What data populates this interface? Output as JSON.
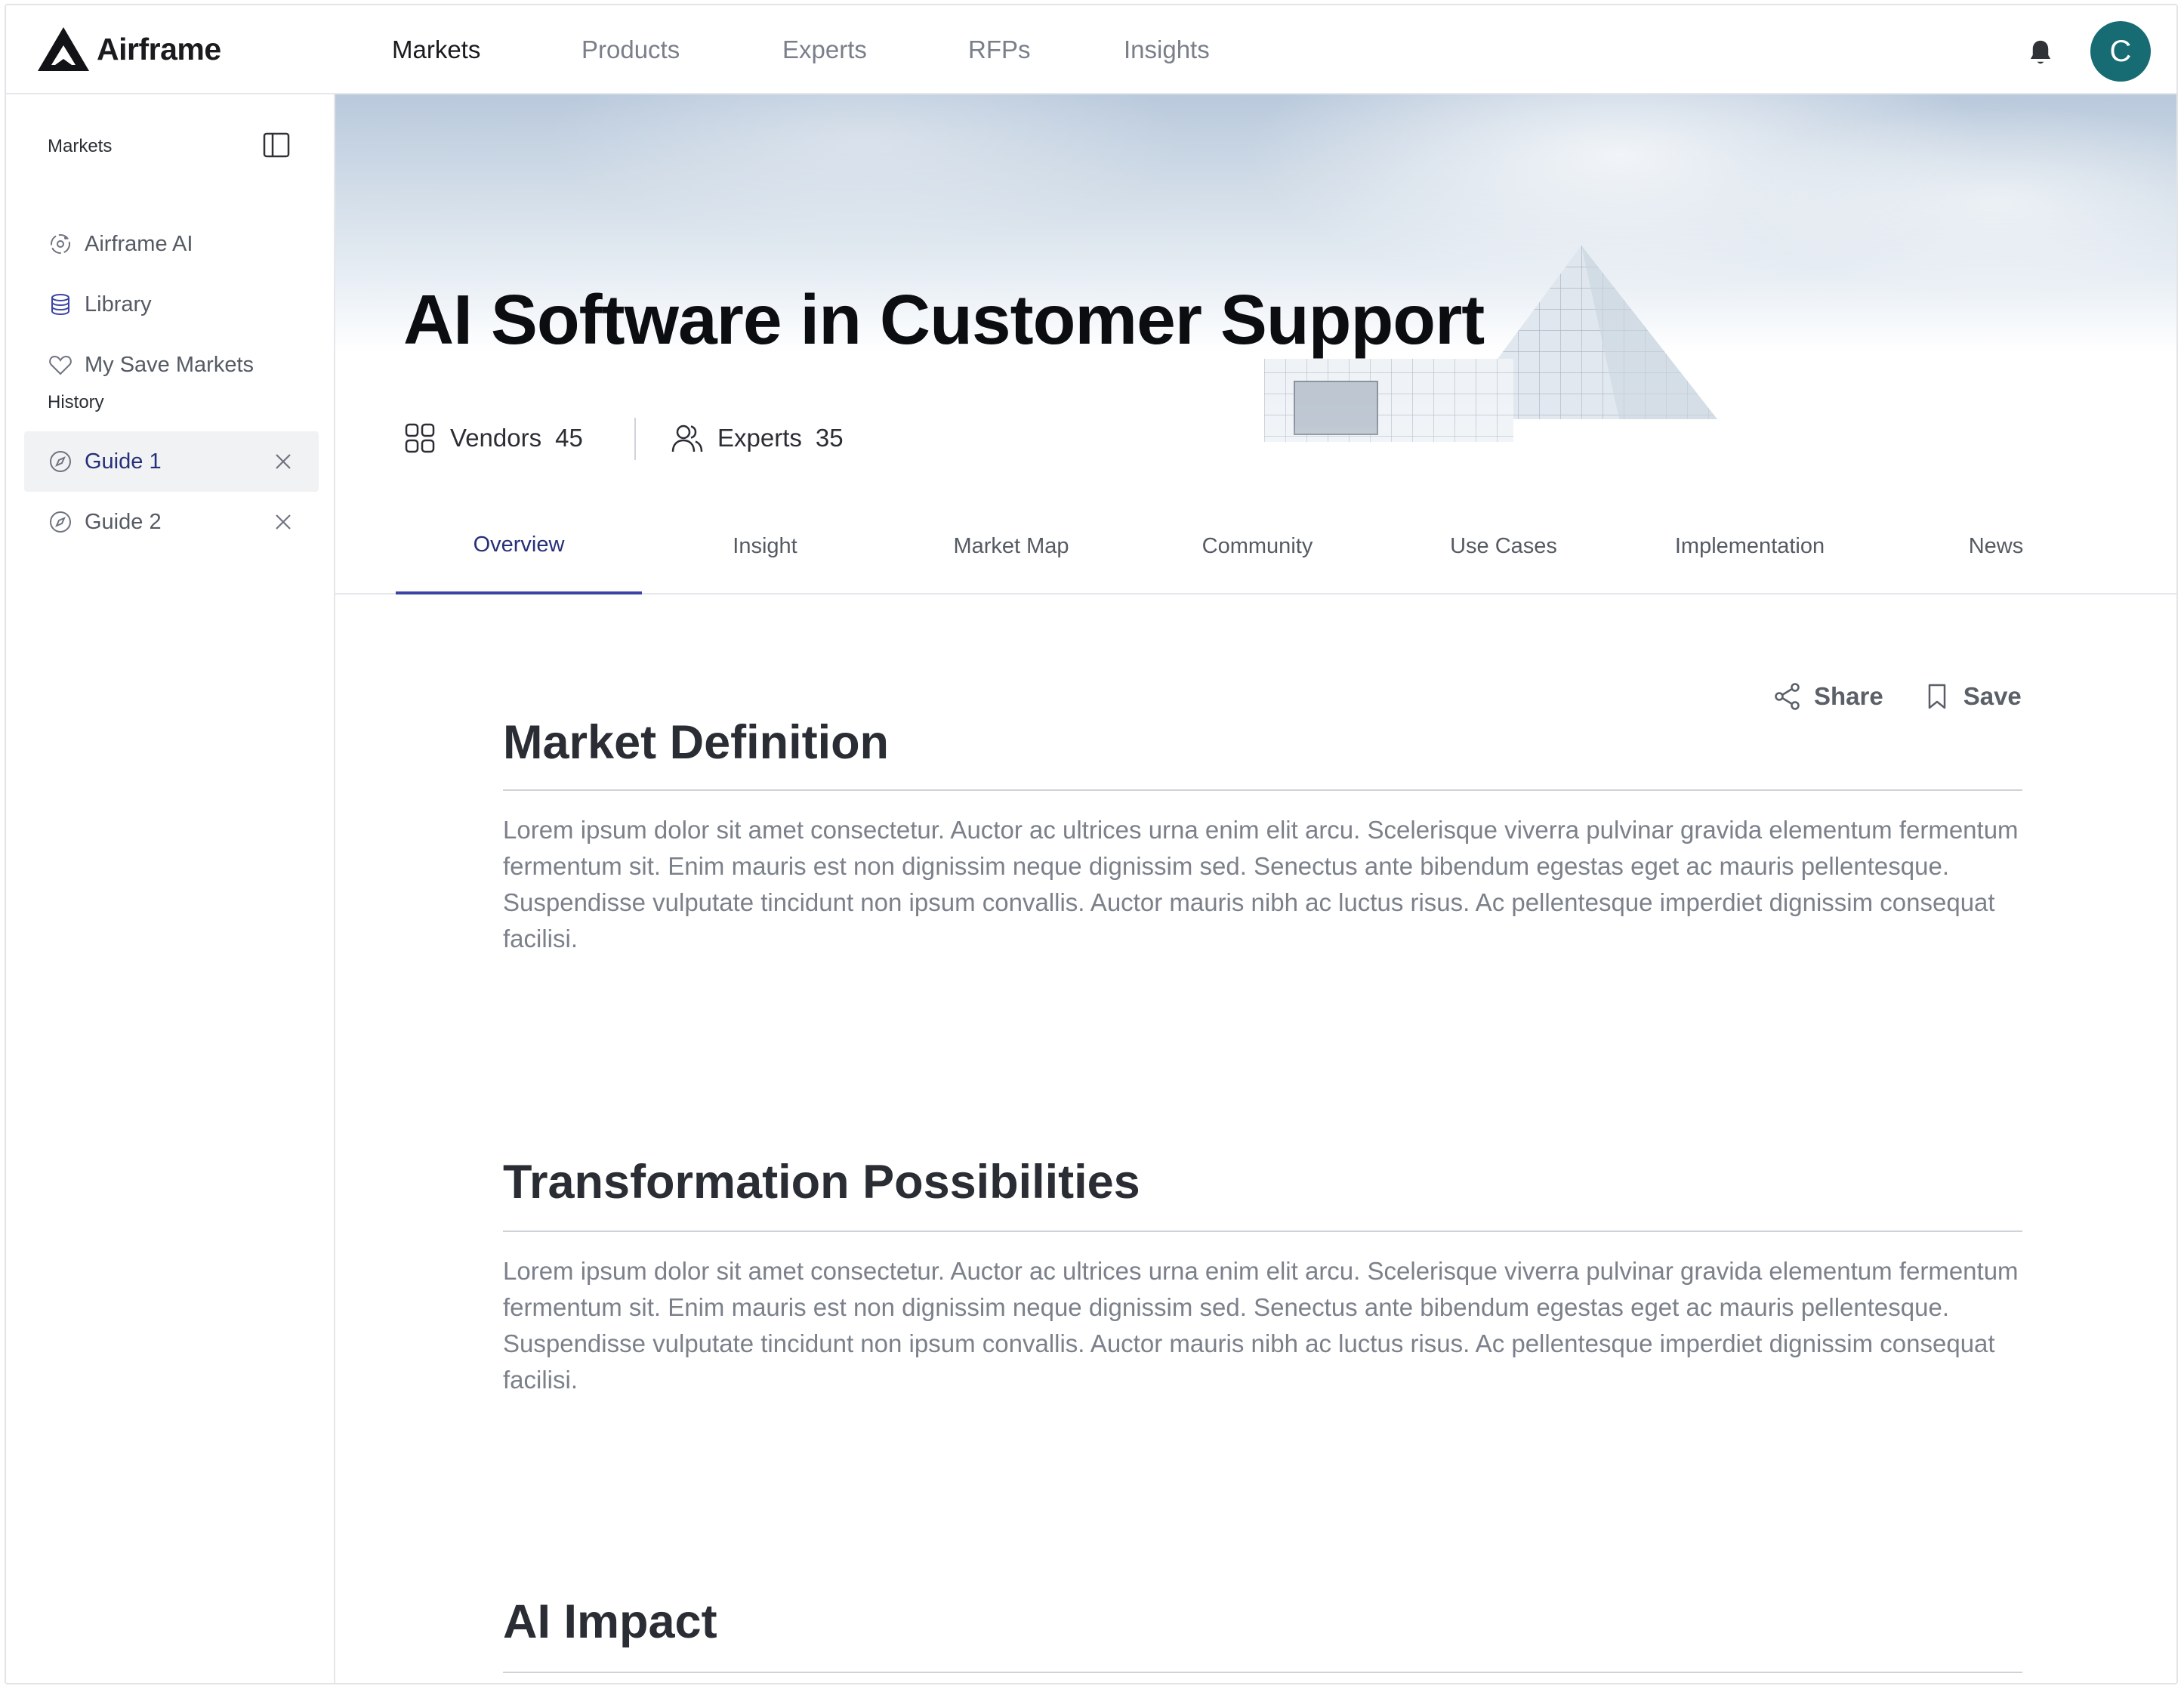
{
  "app": {
    "brand": "Airframe",
    "avatar_initial": "C",
    "accent_color": "#3b44a5",
    "avatar_color": "#176b72"
  },
  "nav": {
    "items": [
      "Markets",
      "Products",
      "Experts",
      "RFPs",
      "Insights"
    ],
    "active": "Markets"
  },
  "sidebar": {
    "title": "Markets",
    "items": [
      "Airframe AI",
      "Library",
      "My Save Markets"
    ],
    "history_title": "History",
    "history": [
      "Guide 1",
      "Guide 2"
    ],
    "selected_history": "Guide 1"
  },
  "hero": {
    "title": "AI Software in Customer Support",
    "vendors_label": "Vendors",
    "vendors_count": "45",
    "experts_label": "Experts",
    "experts_count": "35"
  },
  "tabs": {
    "items": [
      "Overview",
      "Insight",
      "Market Map",
      "Community",
      "Use Cases",
      "Implementation",
      "News"
    ],
    "active": "Overview"
  },
  "actions": {
    "share": "Share",
    "save": "Save"
  },
  "sections": [
    {
      "title": "Market Definition",
      "body": "Lorem ipsum dolor sit amet consectetur. Auctor ac ultrices urna enim elit arcu. Scelerisque viverra pulvinar gravida elementum fermentum fermentum sit. Enim mauris est non dignissim neque dignissim sed. Senectus ante bibendum egestas eget ac mauris pellentesque. Suspendisse vulputate tincidunt non ipsum convallis. Auctor mauris nibh ac luctus risus. Ac pellentesque imperdiet dignissim consequat facilisi."
    },
    {
      "title": "Transformation Possibilities",
      "body": "Lorem ipsum dolor sit amet consectetur. Auctor ac ultrices urna enim elit arcu. Scelerisque viverra pulvinar gravida elementum fermentum fermentum sit. Enim mauris est non dignissim neque dignissim sed. Senectus ante bibendum egestas eget ac mauris pellentesque. Suspendisse vulputate tincidunt non ipsum convallis. Auctor mauris nibh ac luctus risus. Ac pellentesque imperdiet dignissim consequat facilisi."
    },
    {
      "title": "AI Impact",
      "body": ""
    }
  ]
}
